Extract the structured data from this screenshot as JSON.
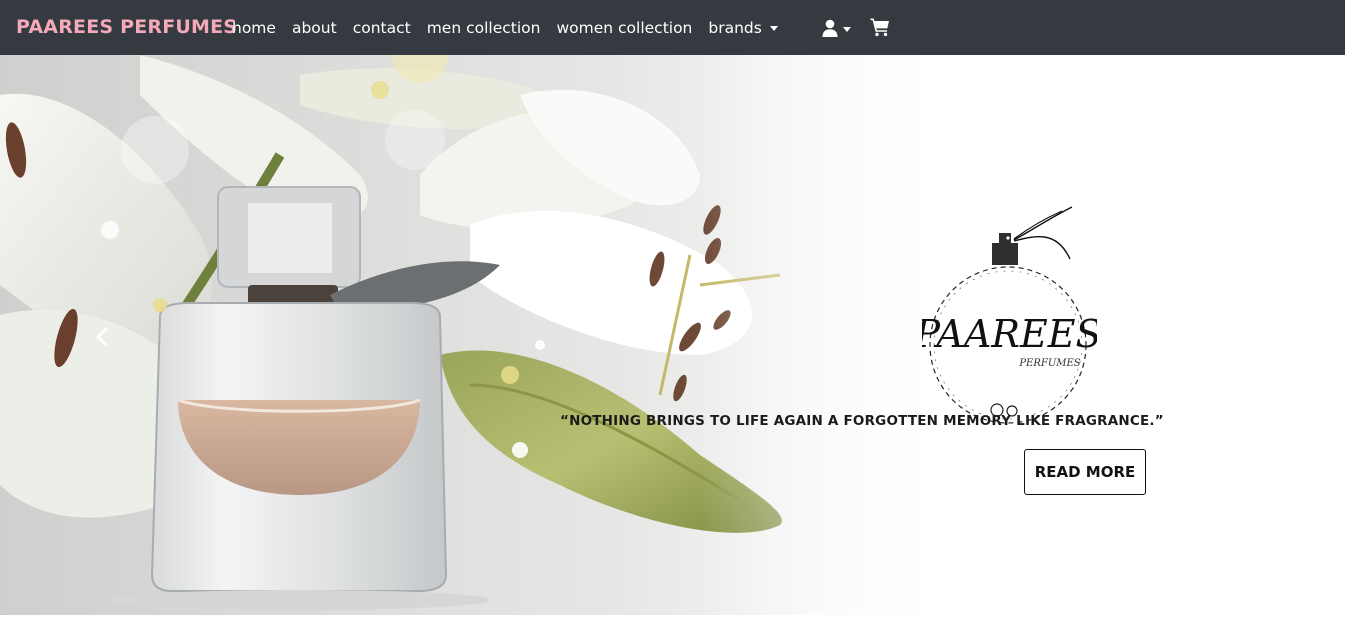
{
  "navbar": {
    "brand": "PAAREES PERFUMES",
    "links": [
      {
        "label": "home"
      },
      {
        "label": "about"
      },
      {
        "label": "contact"
      },
      {
        "label": "men collection"
      },
      {
        "label": "women collection"
      },
      {
        "label": "brands"
      }
    ],
    "icons": {
      "user": "user-icon",
      "cart": "shopping-cart-icon"
    }
  },
  "carousel": {
    "prev_icon": "chevron-left-icon",
    "logo": {
      "title": "PAAREES",
      "subtitle": "PERFUMES"
    },
    "quote": "“NOTHING BRINGS TO LIFE AGAIN A FORGOTTEN MEMORY LIKE FRAGRANCE.”",
    "button_label": "READ MORE"
  },
  "colors": {
    "navbar_bg": "#343a40",
    "brand": "#f4a9b8"
  }
}
